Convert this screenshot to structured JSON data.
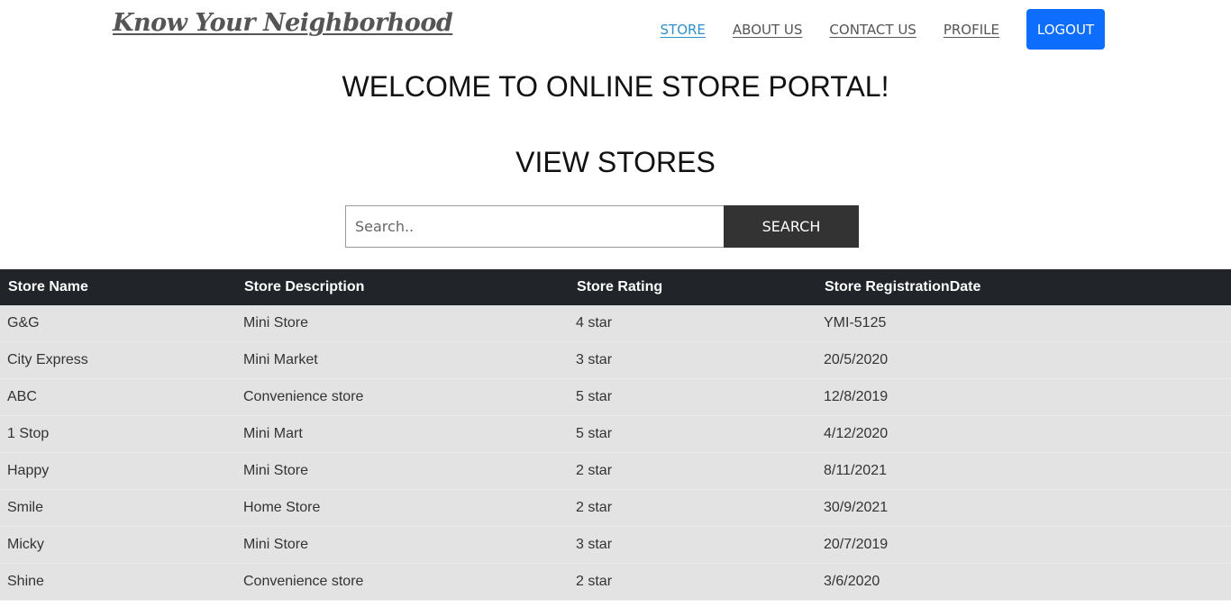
{
  "brand": "Know Your Neighborhood",
  "nav": {
    "links": [
      "STORE",
      "ABOUT US",
      "CONTACT US",
      "PROFILE"
    ],
    "active": "STORE",
    "logout_label": "LOGOUT"
  },
  "welcome_heading": "WELCOME TO ONLINE STORE PORTAL!",
  "section_title": "VIEW STORES",
  "search": {
    "placeholder": "Search..",
    "button_label": "SEARCH"
  },
  "table": {
    "headers": [
      "Store Name",
      "Store Description",
      "Store Rating",
      "Store RegistrationDate"
    ],
    "rows": [
      [
        "G&G",
        "Mini Store",
        "4 star",
        "YMI-5125"
      ],
      [
        "City Express",
        "Mini Market",
        "3 star",
        "20/5/2020"
      ],
      [
        "ABC",
        "Convenience store",
        "5 star",
        "12/8/2019"
      ],
      [
        "1 Stop",
        "Mini Mart",
        "5 star",
        "4/12/2020"
      ],
      [
        "Happy",
        "Mini Store",
        "2 star",
        "8/11/2021"
      ],
      [
        "Smile",
        "Home Store",
        "2 star",
        "30/9/2021"
      ],
      [
        "Micky",
        "Mini Store",
        "3 star",
        "20/7/2019"
      ],
      [
        "Shine",
        "Convenience store",
        "2 star",
        "3/6/2020"
      ]
    ]
  },
  "colors": {
    "accent": "#0d6efd",
    "active_link": "#2f8fc9",
    "table_header_bg": "#212529",
    "table_row_bg": "#e3e3e3",
    "search_button_bg": "#333333"
  }
}
